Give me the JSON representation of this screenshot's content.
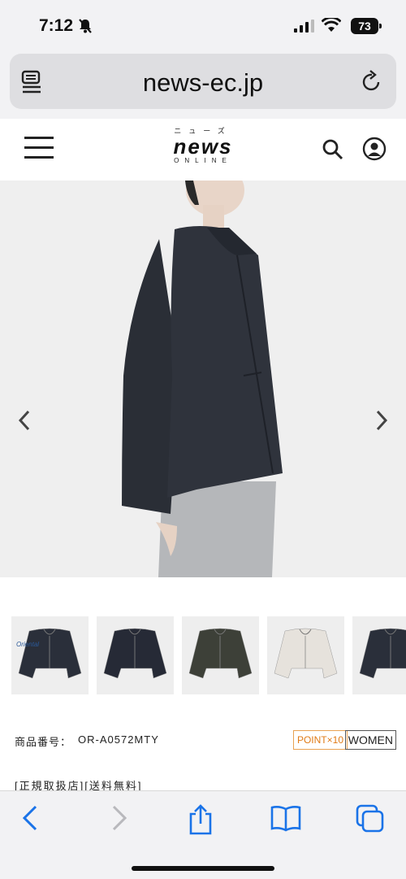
{
  "status": {
    "time": "7:12",
    "battery": "73"
  },
  "browser": {
    "url": "news-ec.jp"
  },
  "site": {
    "logo_kana": "ニューズ",
    "logo_main": "news",
    "logo_sub": "ONLINE"
  },
  "thumbnails": [
    {
      "label": "Oriental",
      "color": "#2a2f3a"
    },
    {
      "label": "",
      "color": "#262a36"
    },
    {
      "label": "",
      "color": "#3d4038"
    },
    {
      "label": "",
      "color": "#e6e2dc"
    },
    {
      "label": "",
      "color": "#2a2f3a"
    }
  ],
  "product": {
    "sku_label": "商品番号：",
    "sku": "OR-A0572MTY",
    "badge_point": "POINT×10",
    "badge_gender": "WOMEN",
    "tags": "[正規取扱店][送料無料]"
  },
  "colors": {
    "accent_point": "#e07b16",
    "ios_blue": "#1a73e8"
  }
}
